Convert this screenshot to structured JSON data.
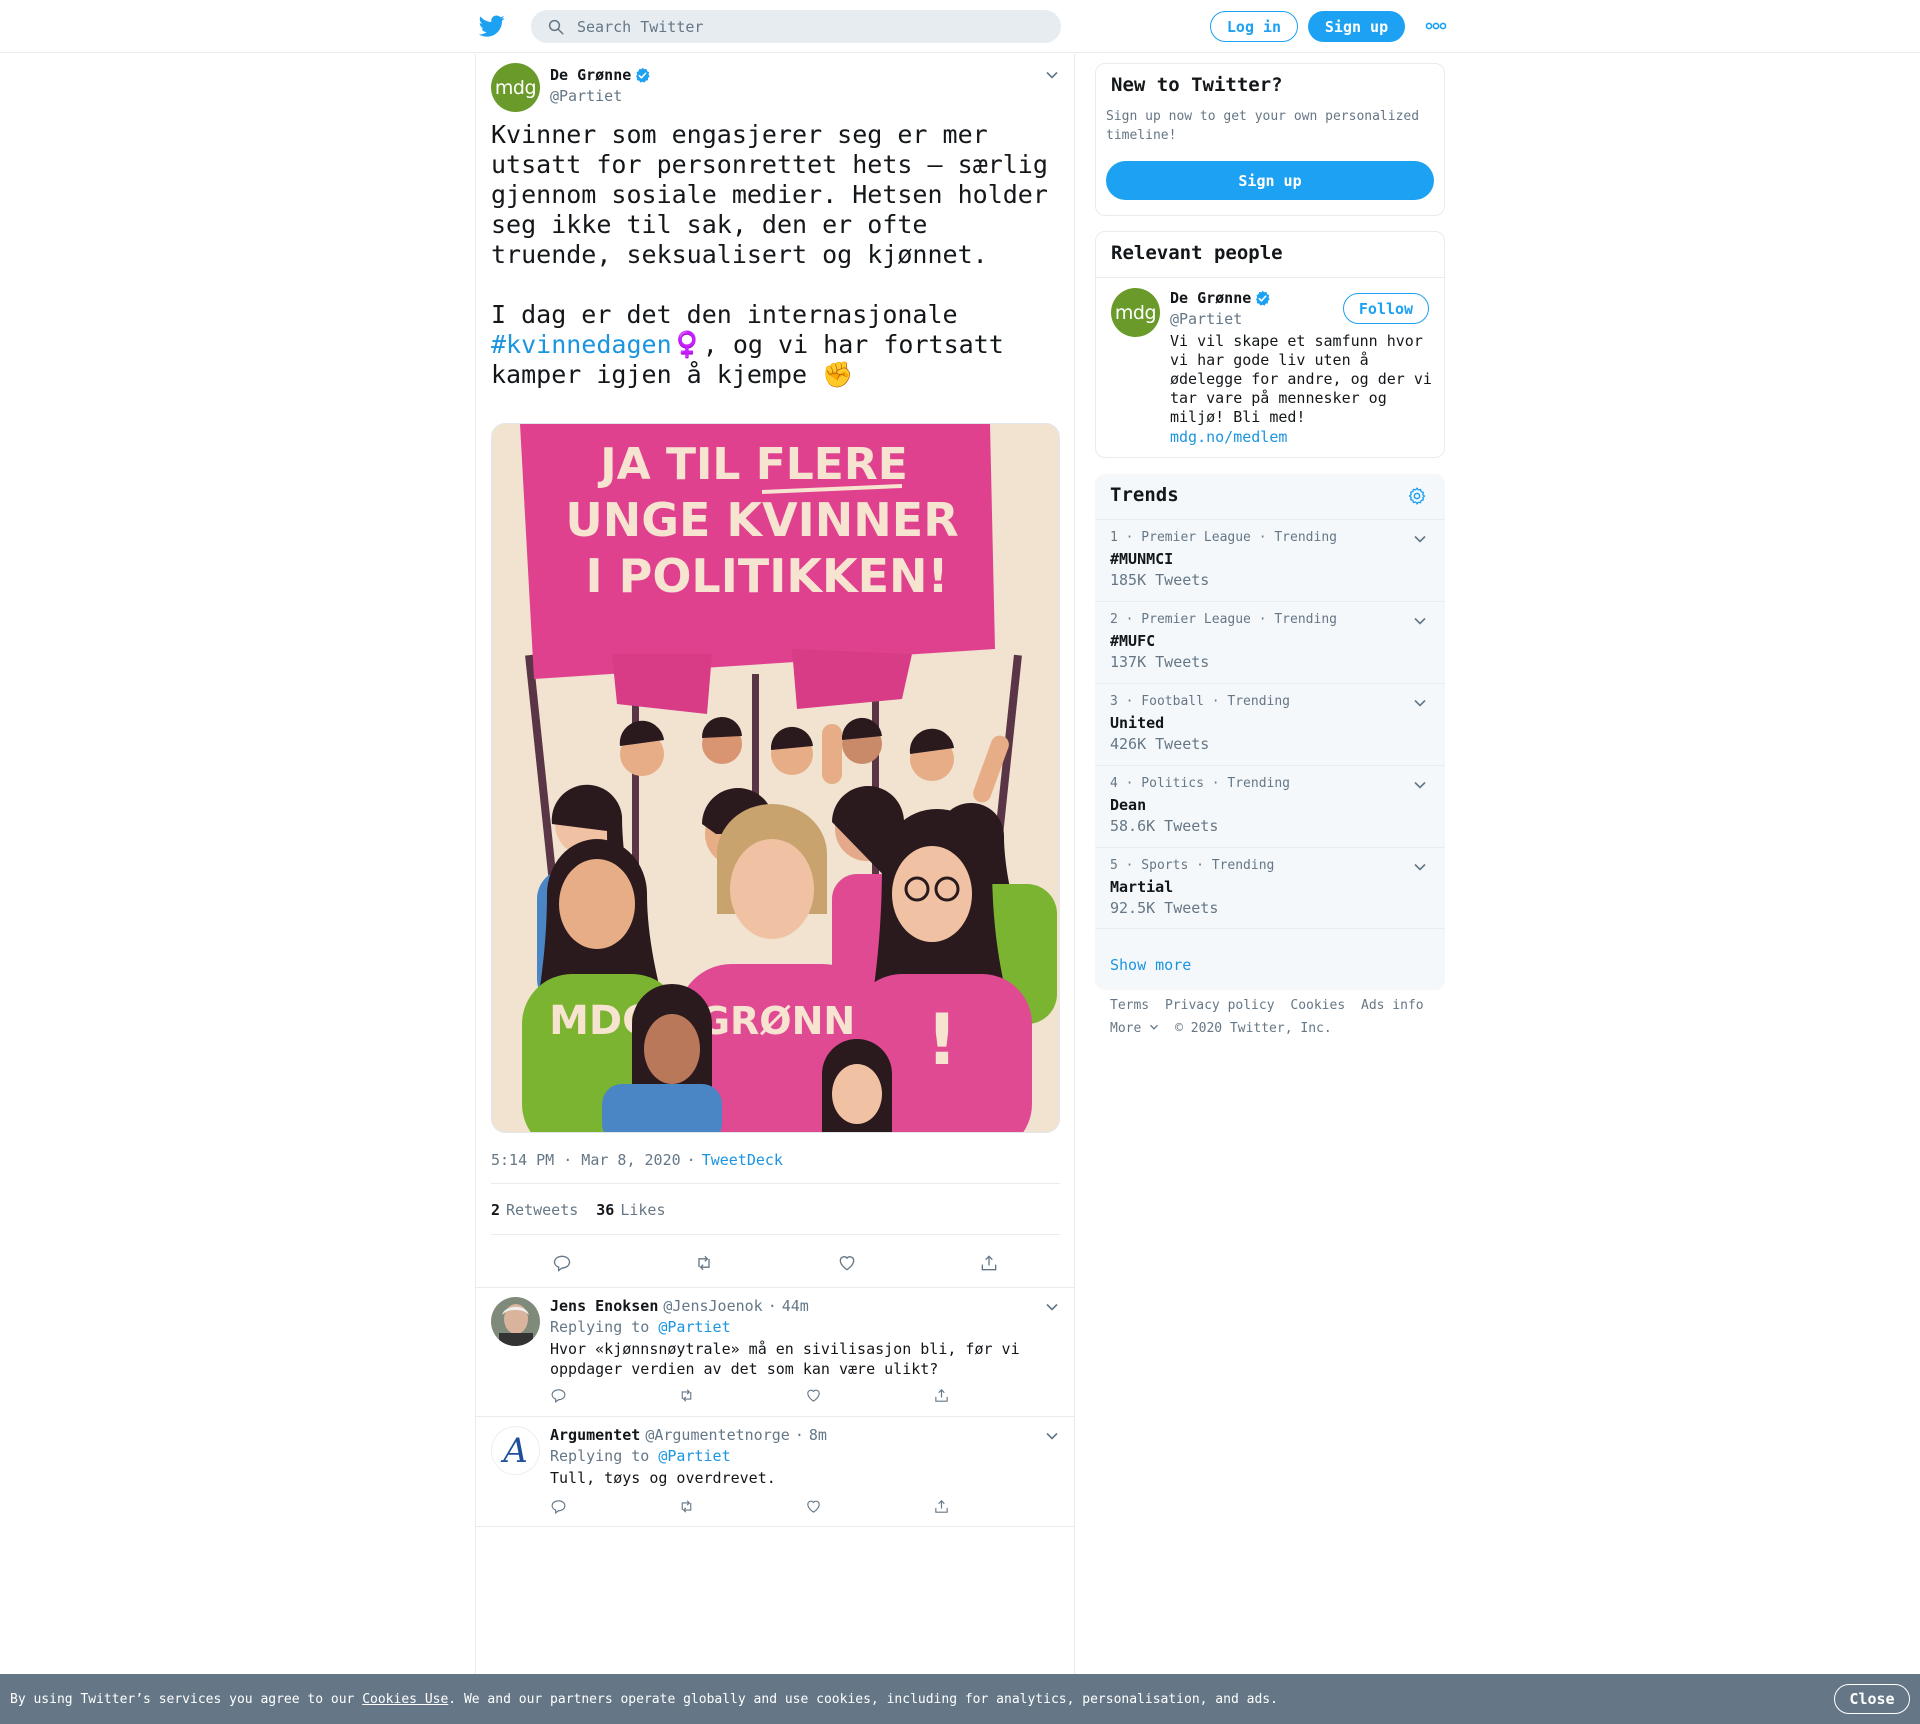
{
  "colors": {
    "accent": "#1da1f2",
    "link": "#1b95e0",
    "muted": "#657786",
    "mdg_green": "#6a9a2a",
    "poster_pink": "#e0418f"
  },
  "header": {
    "search_placeholder": "Search Twitter",
    "login_label": "Log in",
    "signup_label": "Sign up",
    "more_icon": "more-dots-icon"
  },
  "tweet": {
    "avatar_text": "mdg",
    "name": "De Grønne",
    "handle": "@Partiet",
    "text_p1": "Kvinner som engasjerer seg er mer utsatt for personrettet hets – særlig gjennom sosiale medier. Hetsen holder seg ikke til sak, den er ofte truende, seksualisert og kjønnet.",
    "text_p2_start": "I dag er det den internasjonale ",
    "hashtag": "#kvinnedagen",
    "emoji_female": "♀️",
    "text_p2_end": ", og vi har fortsatt kamper igjen å kjempe ",
    "emoji_fist": "✊",
    "image": {
      "banner_line1_a": "JA TIL ",
      "banner_line1_b": "FLERE",
      "banner_line2": "UNGE KVINNER",
      "banner_line3": "I POLITIKKEN!",
      "shirt_text_1": "MDG",
      "shirt_text_2": "GRØNN",
      "shirt_text_3": "!"
    },
    "time": "5:14 PM · Mar 8, 2020",
    "source": "TweetDeck",
    "retweets_count": "2",
    "retweets_label": "Retweets",
    "likes_count": "36",
    "likes_label": "Likes"
  },
  "replies": [
    {
      "name": "Jens Enoksen",
      "handle": "@JensJoenok",
      "age": "44m",
      "replying_label": "Replying to",
      "replying_to": "@Partiet",
      "text": "Hvor «kjønnsnøytrale» må en sivilisasjon bli, før vi oppdager verdien av det som kan være ulikt?"
    },
    {
      "name": "Argumentet",
      "handle": "@Argumentetnorge",
      "age": "8m",
      "replying_label": "Replying to",
      "replying_to": "@Partiet",
      "avatar_letter": "A",
      "text": "Tull, tøys og overdrevet."
    }
  ],
  "sidebar": {
    "new_to_twitter": {
      "title": "New to Twitter?",
      "description": "Sign up now to get your own personalized timeline!",
      "button": "Sign up"
    },
    "relevant_people": {
      "title": "Relevant people",
      "name": "De Grønne",
      "handle": "@Partiet",
      "follow_label": "Follow",
      "bio": "Vi vil skape et samfunn hvor vi har gode liv uten å ødelegge for andre, og der vi tar vare på mennesker og miljø! Bli med!",
      "link": "mdg.no/medlem"
    },
    "trends": {
      "title": "Trends",
      "items": [
        {
          "meta": "1 · Premier League · Trending",
          "name": "#MUNMCI",
          "count": "185K Tweets"
        },
        {
          "meta": "2 · Premier League · Trending",
          "name": "#MUFC",
          "count": "137K Tweets"
        },
        {
          "meta": "3 · Football · Trending",
          "name": "United",
          "count": "426K Tweets"
        },
        {
          "meta": "4 · Politics · Trending",
          "name": "Dean",
          "count": "58.6K Tweets"
        },
        {
          "meta": "5 · Sports · Trending",
          "name": "Martial",
          "count": "92.5K Tweets"
        }
      ],
      "show_more": "Show more"
    },
    "footer": {
      "terms": "Terms",
      "privacy": "Privacy policy",
      "cookies": "Cookies",
      "ads": "Ads info",
      "more": "More",
      "copyright": "© 2020 Twitter, Inc."
    }
  },
  "cookie_banner": {
    "text_before": "By using Twitter’s services you agree to our ",
    "link": "Cookies Use",
    "text_after": ". We and our partners operate globally and use cookies, including for analytics, personalisation, and ads.",
    "close_label": "Close"
  }
}
